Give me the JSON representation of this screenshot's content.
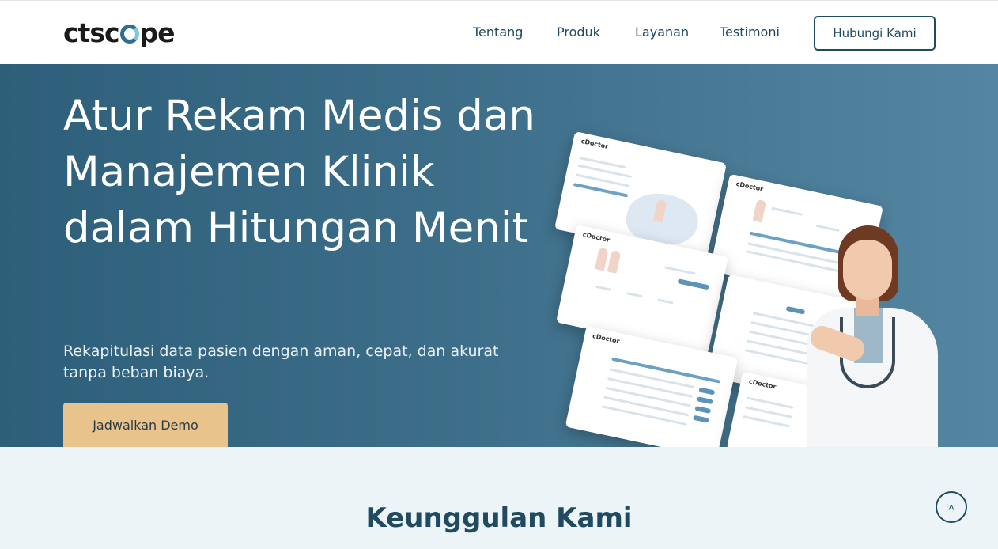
{
  "header": {
    "logo": {
      "prefix": "ctsc",
      "suffix": "pe"
    },
    "nav": [
      "Tentang",
      "Produk",
      "Layanan",
      "Testimoni"
    ],
    "cta": "Hubungi Kami"
  },
  "hero": {
    "title": "Atur Rekam Medis dan Manajemen Klinik dalam Hitungan Menit",
    "subtitle": "Rekapitulasi data pasien dengan aman, cepat, dan akurat tanpa beban biaya.",
    "demo_button": "Jadwalkan Demo",
    "mockup_logo": "cDoctor"
  },
  "section": {
    "title": "Keunggulan Kami"
  },
  "scroll_top": {
    "icon": "chevron-up-icon",
    "glyph": "˄"
  },
  "colors": {
    "primary": "#1f4a60",
    "accent": "#e8c48c",
    "hero_bg": "#3d6e89",
    "section_bg": "#edf4f8"
  }
}
